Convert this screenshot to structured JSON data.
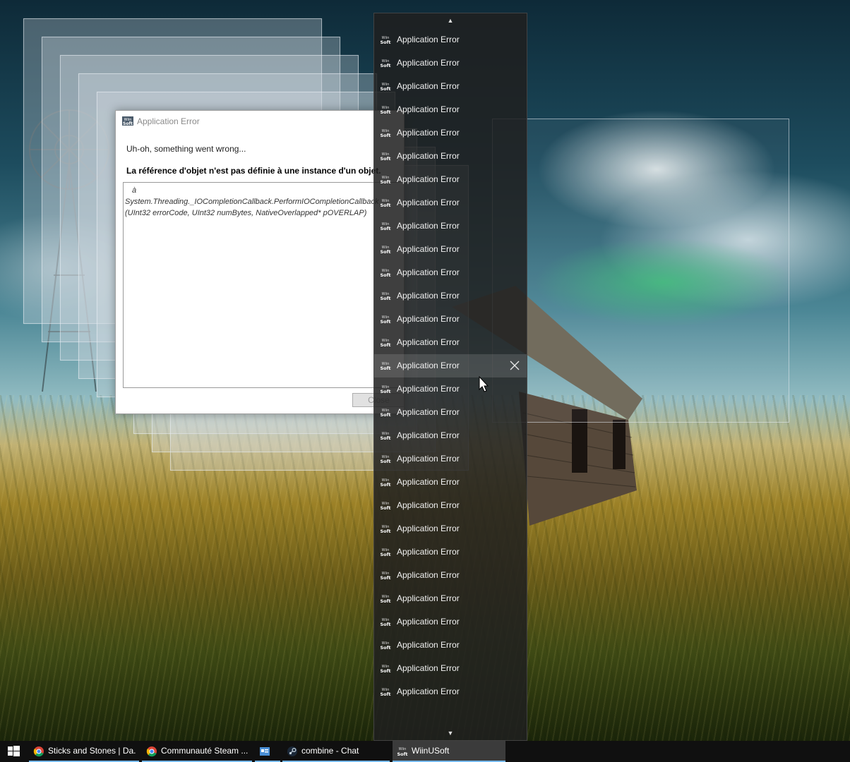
{
  "dialog": {
    "title": "Application Error",
    "message": "Uh-oh, something went wrong...",
    "error": "La référence d'objet n'est pas définie à une instance d'un objet.",
    "trace_lines": [
      "à",
      "System.Threading._IOCompletionCallback.PerformIOCompletionCallback",
      "(UInt32 errorCode, UInt32 numBytes, NativeOverlapped* pOVERLAP)"
    ],
    "close_label": "Close"
  },
  "jumplist": {
    "scroll_up_glyph": "▲",
    "scroll_down_glyph": "▼",
    "item_icon": "wiinusoft-icon",
    "items": [
      "Application Error",
      "Application Error",
      "Application Error",
      "Application Error",
      "Application Error",
      "Application Error",
      "Application Error",
      "Application Error",
      "Application Error",
      "Application Error",
      "Application Error",
      "Application Error",
      "Application Error",
      "Application Error",
      "Application Error",
      "Application Error",
      "Application Error",
      "Application Error",
      "Application Error",
      "Application Error",
      "Application Error",
      "Application Error",
      "Application Error",
      "Application Error",
      "Application Error",
      "Application Error",
      "Application Error",
      "Application Error",
      "Application Error",
      "Application Error"
    ],
    "hovered_index": 14,
    "close_glyph": "✕"
  },
  "taskbar": {
    "items": [
      {
        "label": "Sticks and Stones | Da...",
        "icon": "chrome-icon",
        "active": false
      },
      {
        "label": "Communauté Steam ...",
        "icon": "chrome-icon",
        "active": false
      },
      {
        "label": "",
        "icon": "app-icon",
        "active": false
      },
      {
        "label": "combine - Chat",
        "icon": "steam-icon",
        "active": false
      },
      {
        "label": "WiinUSoft",
        "icon": "wiinusoft-icon",
        "active": true
      }
    ]
  },
  "colors": {
    "taskbar_bg": "#101010",
    "accent_underline": "#76b9ed",
    "jumplist_bg": "#202020"
  }
}
